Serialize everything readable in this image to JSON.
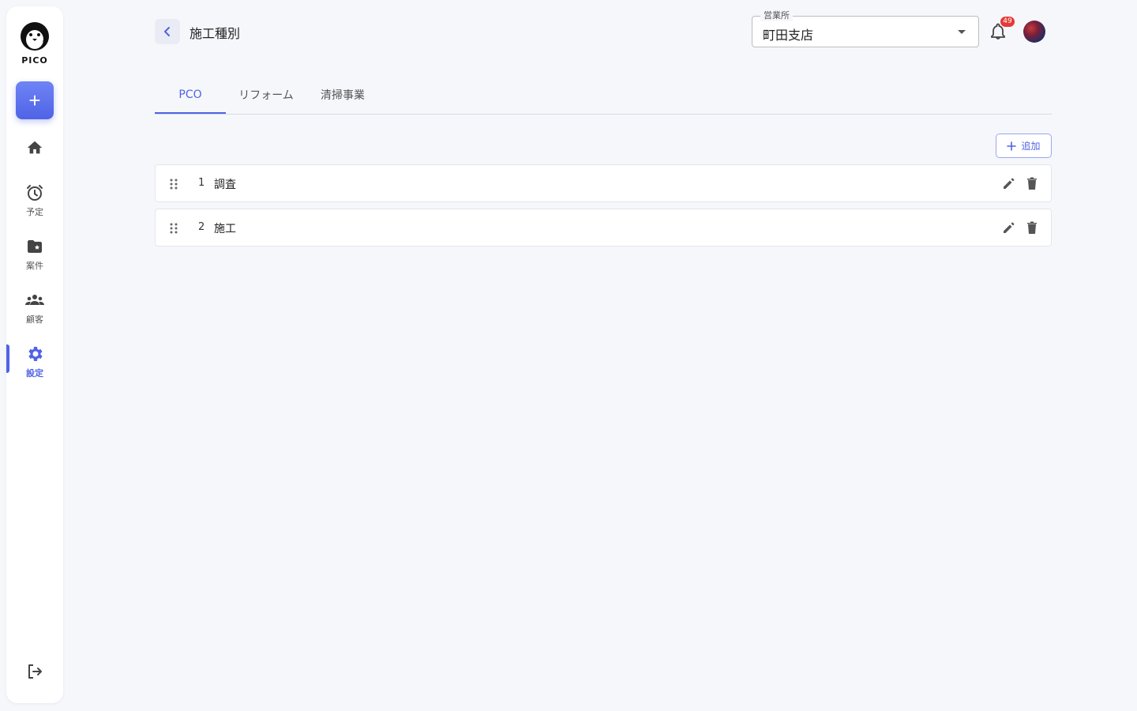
{
  "sidebar": {
    "logo_text": "PICO",
    "add_label": "+",
    "items": [
      {
        "label": "",
        "icon": "home-icon"
      },
      {
        "label": "予定",
        "icon": "alarm-clock-icon"
      },
      {
        "label": "案件",
        "icon": "folder-star-icon"
      },
      {
        "label": "顧客",
        "icon": "people-icon"
      },
      {
        "label": "設定",
        "icon": "gear-icon",
        "active": true
      }
    ],
    "logout_icon": "logout-icon"
  },
  "header": {
    "title": "施工種別",
    "office_select": {
      "legend": "営業所",
      "value": "町田支店"
    },
    "notification_count": "49"
  },
  "tabs": [
    {
      "label": "PCO",
      "active": true
    },
    {
      "label": "リフォーム"
    },
    {
      "label": "清掃事業"
    }
  ],
  "add_button_label": "追加",
  "rows": [
    {
      "number": "1",
      "name": "調査"
    },
    {
      "number": "2",
      "name": "施工"
    }
  ],
  "colors": {
    "accent": "#4f63e6",
    "background": "#f6f7fb",
    "badge": "#e53935"
  }
}
